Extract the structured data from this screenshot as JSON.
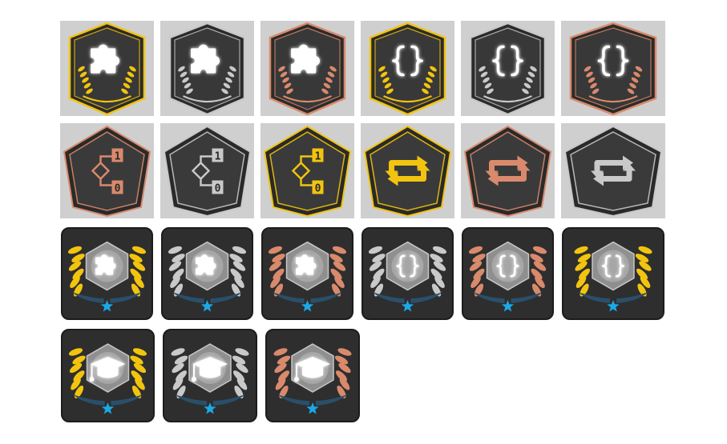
{
  "colors": {
    "gold": "#f2c40f",
    "silver": "#c9c9c9",
    "bronze": "#d98a6c",
    "badge_dark": "#3c3c3c",
    "cell_bg": "#cfcfcf",
    "star": "#1aa9e8",
    "wing": "#2a4f6a"
  },
  "row1": [
    {
      "icon": "puzzle-icon",
      "tier": "gold",
      "shape": "hexagon-laurel"
    },
    {
      "icon": "puzzle-icon",
      "tier": "silver",
      "shape": "hexagon-laurel"
    },
    {
      "icon": "puzzle-icon",
      "tier": "bronze",
      "shape": "hexagon-laurel"
    },
    {
      "icon": "braces-icon",
      "tier": "gold",
      "shape": "hexagon-laurel"
    },
    {
      "icon": "braces-icon",
      "tier": "silver",
      "shape": "hexagon-laurel"
    },
    {
      "icon": "braces-icon",
      "tier": "bronze",
      "shape": "hexagon-laurel"
    }
  ],
  "row2": [
    {
      "icon": "branch-icon",
      "tier": "bronze",
      "shape": "pentagon",
      "labels": [
        "1",
        "0"
      ]
    },
    {
      "icon": "branch-icon",
      "tier": "silver",
      "shape": "pentagon",
      "labels": [
        "1",
        "0"
      ]
    },
    {
      "icon": "branch-icon",
      "tier": "gold",
      "shape": "pentagon",
      "labels": [
        "1",
        "0"
      ]
    },
    {
      "icon": "loop-icon",
      "tier": "gold",
      "shape": "pentagon"
    },
    {
      "icon": "loop-icon",
      "tier": "bronze",
      "shape": "pentagon"
    },
    {
      "icon": "loop-icon",
      "tier": "silver",
      "shape": "pentagon"
    }
  ],
  "row3": [
    {
      "icon": "puzzle-icon",
      "tier": "gold",
      "shape": "wreath-star"
    },
    {
      "icon": "puzzle-icon",
      "tier": "silver",
      "shape": "wreath-star"
    },
    {
      "icon": "puzzle-icon",
      "tier": "bronze",
      "shape": "wreath-star"
    },
    {
      "icon": "braces-icon",
      "tier": "silver",
      "shape": "wreath-star"
    },
    {
      "icon": "braces-icon",
      "tier": "bronze",
      "shape": "wreath-star"
    },
    {
      "icon": "braces-icon",
      "tier": "gold",
      "shape": "wreath-star"
    }
  ],
  "row4": [
    {
      "icon": "graduation-cap-icon",
      "tier": "gold",
      "shape": "wreath-star"
    },
    {
      "icon": "graduation-cap-icon",
      "tier": "silver",
      "shape": "wreath-star"
    },
    {
      "icon": "graduation-cap-icon",
      "tier": "bronze",
      "shape": "wreath-star"
    }
  ]
}
